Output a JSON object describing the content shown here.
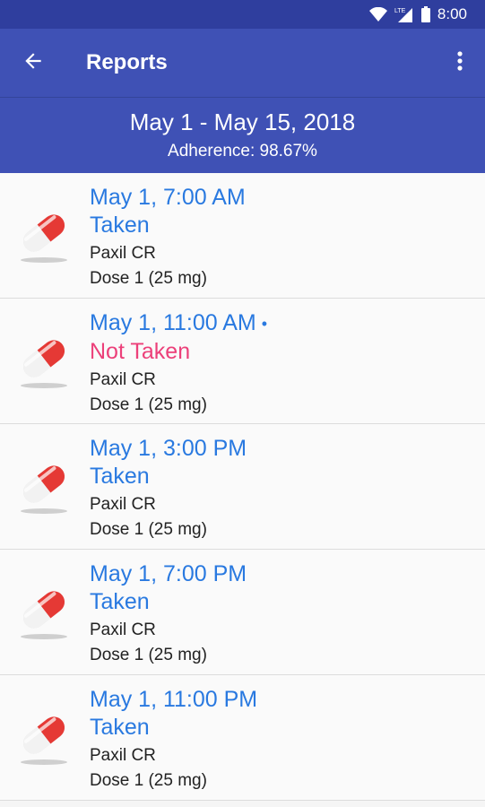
{
  "status_bar": {
    "time": "8:00",
    "network": "LTE"
  },
  "app_bar": {
    "title": "Reports"
  },
  "summary": {
    "range": "May 1 - May 15, 2018",
    "adherence": "Adherence: 98.67%"
  },
  "entries": [
    {
      "time": "May 1, 7:00 AM",
      "status": "Taken",
      "drug": "Paxil CR",
      "dose": "Dose 1 (25 mg)"
    },
    {
      "time": "May 1, 11:00 AM",
      "dot": "•",
      "status": "Not Taken",
      "drug": "Paxil CR",
      "dose": "Dose 1 (25 mg)"
    },
    {
      "time": "May 1, 3:00 PM",
      "status": "Taken",
      "drug": "Paxil CR",
      "dose": "Dose 1 (25 mg)"
    },
    {
      "time": "May 1, 7:00 PM",
      "status": "Taken",
      "drug": "Paxil CR",
      "dose": "Dose 1 (25 mg)"
    },
    {
      "time": "May 1, 11:00 PM",
      "status": "Taken",
      "drug": "Paxil CR",
      "dose": "Dose 1 (25 mg)"
    }
  ],
  "colors": {
    "primary": "#3f51b5",
    "status_bar": "#2f3e9e",
    "taken": "#2979e0",
    "not_taken": "#ec407a",
    "pill_red": "#e53935"
  },
  "icons": [
    "back-arrow-icon",
    "overflow-menu-icon",
    "wifi-icon",
    "lte-signal-icon",
    "battery-icon",
    "pill-icon"
  ]
}
